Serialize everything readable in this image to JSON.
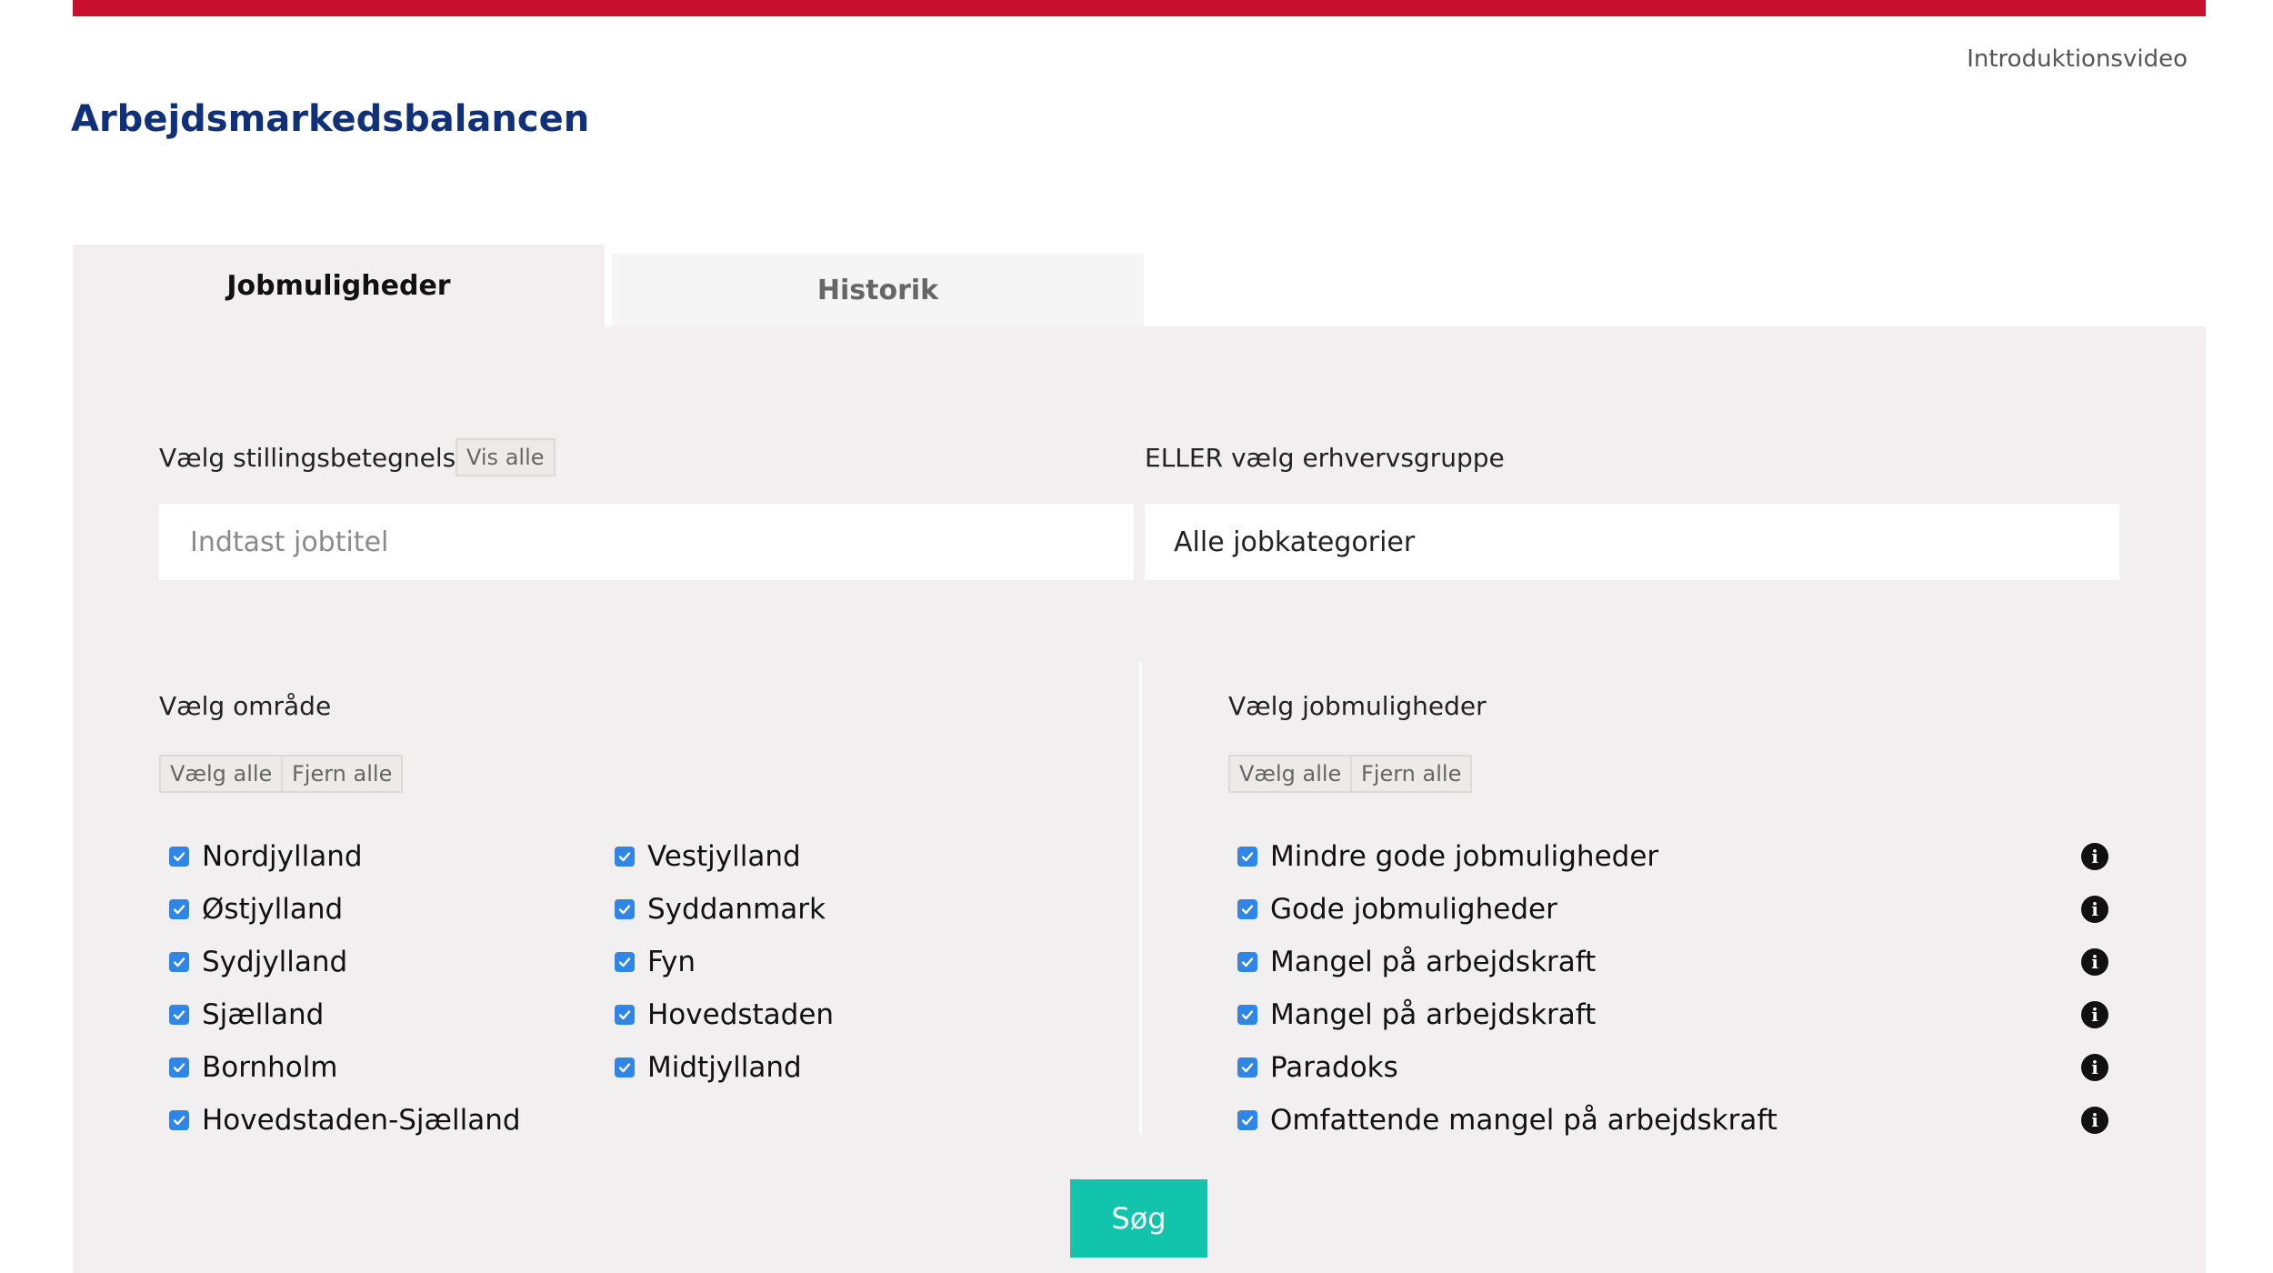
{
  "header": {
    "intro_link": "Introduktionsvideo",
    "title": "Arbejdsmarkedsbalancen"
  },
  "tabs": [
    {
      "label": "Jobmuligheder",
      "active": true
    },
    {
      "label": "Historik",
      "active": false
    }
  ],
  "job_title": {
    "label": "Vælg stillingsbetegnelse",
    "show_all": "Vis alle",
    "placeholder": "Indtast jobtitel",
    "value": ""
  },
  "industry": {
    "label": "ELLER vælg erhvervsgruppe",
    "value": "Alle jobkategorier"
  },
  "area": {
    "label": "Vælg område",
    "select_all": "Vælg alle",
    "remove_all": "Fjern alle",
    "col1": [
      {
        "label": "Nordjylland",
        "checked": true
      },
      {
        "label": "Østjylland",
        "checked": true
      },
      {
        "label": "Sydjylland",
        "checked": true
      },
      {
        "label": "Sjælland",
        "checked": true
      },
      {
        "label": "Bornholm",
        "checked": true
      },
      {
        "label": "Hovedstaden-Sjælland",
        "checked": true
      }
    ],
    "col2": [
      {
        "label": "Vestjylland",
        "checked": true
      },
      {
        "label": "Syddanmark",
        "checked": true
      },
      {
        "label": "Fyn",
        "checked": true
      },
      {
        "label": "Hovedstaden",
        "checked": true
      },
      {
        "label": "Midtjylland",
        "checked": true
      }
    ]
  },
  "opportunities": {
    "label": "Vælg jobmuligheder",
    "select_all": "Vælg alle",
    "remove_all": "Fjern alle",
    "items": [
      {
        "label": "Mindre gode jobmuligheder",
        "checked": true,
        "icon": "info-icon"
      },
      {
        "label": "Gode jobmuligheder",
        "checked": true,
        "icon": "info-icon"
      },
      {
        "label": "Mangel på arbejdskraft",
        "checked": true,
        "icon": "info-icon"
      },
      {
        "label": "Mangel på arbejdskraft",
        "checked": true,
        "icon": "info-icon"
      },
      {
        "label": "Paradoks",
        "checked": true,
        "icon": "info-icon"
      },
      {
        "label": "Omfattende mangel på arbejdskraft",
        "checked": true,
        "icon": "info-icon"
      }
    ]
  },
  "search_button": "Søg",
  "colors": {
    "accent_red": "#c8102e",
    "title_blue": "#10317a",
    "checkbox_blue": "#2f86e6",
    "search_teal": "#12c4ac",
    "panel_bg": "#f1efef"
  }
}
